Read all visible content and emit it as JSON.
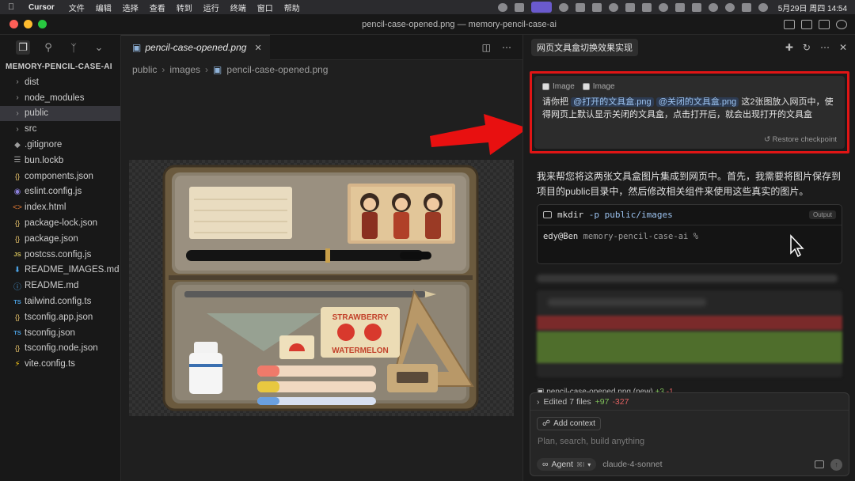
{
  "menubar": {
    "app": "Cursor",
    "items": [
      "文件",
      "编辑",
      "选择",
      "查看",
      "转到",
      "运行",
      "终端",
      "窗口",
      "帮助"
    ],
    "clock": "5月29日 周四 14:54"
  },
  "window": {
    "title": "pencil-case-opened.png — memory-pencil-case-ai"
  },
  "sidebar": {
    "root": "MEMORY-PENCIL-CASE-AI",
    "items": [
      {
        "label": "dist",
        "icon": "chevron-right-icon"
      },
      {
        "label": "node_modules",
        "icon": "chevron-right-icon"
      },
      {
        "label": "public",
        "icon": "chevron-right-icon"
      },
      {
        "label": "src",
        "icon": "chevron-right-icon"
      },
      {
        "label": ".gitignore",
        "icon": "git-icon"
      },
      {
        "label": "bun.lockb",
        "icon": "file-icon"
      },
      {
        "label": "components.json",
        "icon": "json-icon"
      },
      {
        "label": "eslint.config.js",
        "icon": "eslint-icon"
      },
      {
        "label": "index.html",
        "icon": "html-icon"
      },
      {
        "label": "package-lock.json",
        "icon": "json-icon"
      },
      {
        "label": "package.json",
        "icon": "json-icon"
      },
      {
        "label": "postcss.config.js",
        "icon": "js-icon"
      },
      {
        "label": "README_IMAGES.md",
        "icon": "markdown-icon"
      },
      {
        "label": "README.md",
        "icon": "info-icon"
      },
      {
        "label": "tailwind.config.ts",
        "icon": "ts-icon"
      },
      {
        "label": "tsconfig.app.json",
        "icon": "json-icon"
      },
      {
        "label": "tsconfig.json",
        "icon": "ts-icon"
      },
      {
        "label": "tsconfig.node.json",
        "icon": "json-icon"
      },
      {
        "label": "vite.config.ts",
        "icon": "vite-icon"
      }
    ]
  },
  "editor": {
    "tab_label": "pencil-case-opened.png",
    "breadcrumb": [
      "public",
      "images",
      "pencil-case-opened.png"
    ],
    "image": {
      "label_top": "STRAWBERRY",
      "label_bottom": "WATERMELON"
    }
  },
  "chat": {
    "title": "网页文具盒切换效果实现",
    "chips": [
      "Image",
      "Image"
    ],
    "user_text_pre": "请你把",
    "mention_1": "@打开的文具盒.png",
    "mention_2": "@关闭的文具盒.png",
    "user_text_post": "这2张图放入网页中，使得网页上默认显示关闭的文具盒，点击打开后，就会出现打开的文具盒",
    "restore": "Restore checkpoint",
    "ai_text": "我来帮您将这两张文具盒图片集成到网页中。首先，我需要将图片保存到项目的public目录中，然后修改相关组件来使用这些真实的图片。",
    "terminal": {
      "cmd": "mkdir",
      "args": "-p public/images",
      "output_badge": "Output",
      "prompt_user": "edy@Ben",
      "prompt_path": "memory-pencil-case-ai %"
    },
    "changes": {
      "file": "pencil-case-opened.png",
      "tag": "(new)",
      "plus": "+3",
      "minus": "-1"
    },
    "composer": {
      "edited": "Edited 7 files",
      "plus": "+97",
      "minus": "-327",
      "add_context": "Add context",
      "placeholder": "Plan, search, build anything",
      "agent": "Agent",
      "agent_shortcut": "⌘I",
      "model": "claude-4-sonnet"
    }
  },
  "colors": {
    "highlight_border": "#e01515",
    "arrow": "#e81010",
    "accent": "#9cc3f0"
  }
}
